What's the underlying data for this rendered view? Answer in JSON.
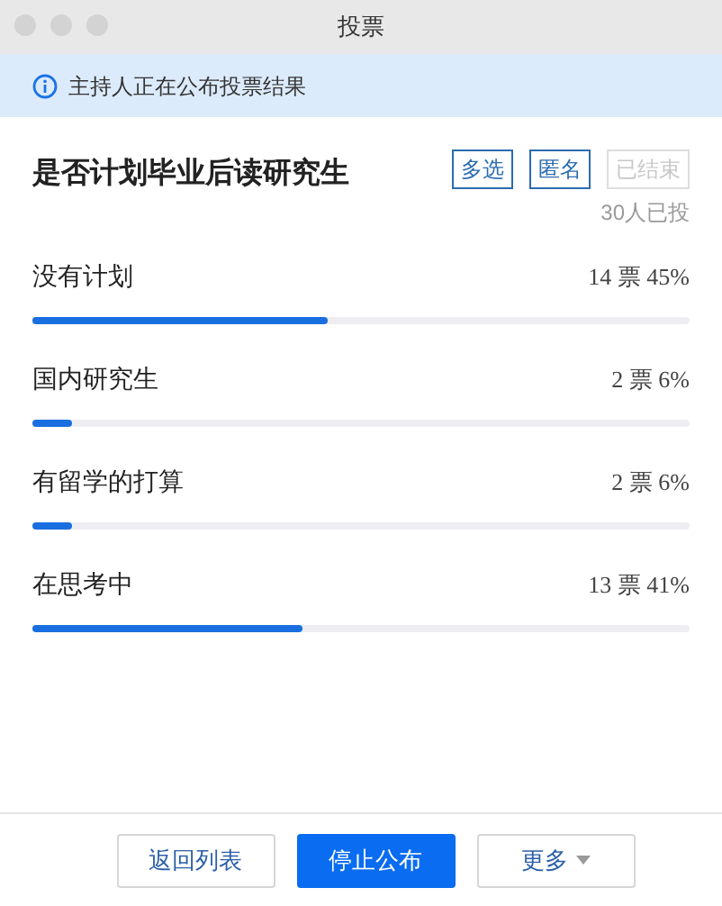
{
  "window": {
    "title": "投票"
  },
  "banner": {
    "text": "主持人正在公布投票结果"
  },
  "poll": {
    "question": "是否计划毕业后读研究生",
    "tags": [
      {
        "label": "多选",
        "active": true
      },
      {
        "label": "匿名",
        "active": true
      },
      {
        "label": "已结束",
        "active": false
      }
    ],
    "voters": "30人已投",
    "options": [
      {
        "label": "没有计划",
        "result": "14 票 45%",
        "level": 0.45
      },
      {
        "label": "国内研究生",
        "result": "2 票 6%",
        "level": 0.06
      },
      {
        "label": "有留学的打算",
        "result": "2 票 6%",
        "level": 0.06
      },
      {
        "label": "在思考中",
        "result": "13 票 41%",
        "level": 0.41
      }
    ]
  },
  "buttons": [
    {
      "label": "返回列表",
      "kind": "secondary"
    },
    {
      "label": "停止公布",
      "kind": "primary"
    },
    {
      "label": "更多",
      "kind": "dropdown"
    }
  ]
}
